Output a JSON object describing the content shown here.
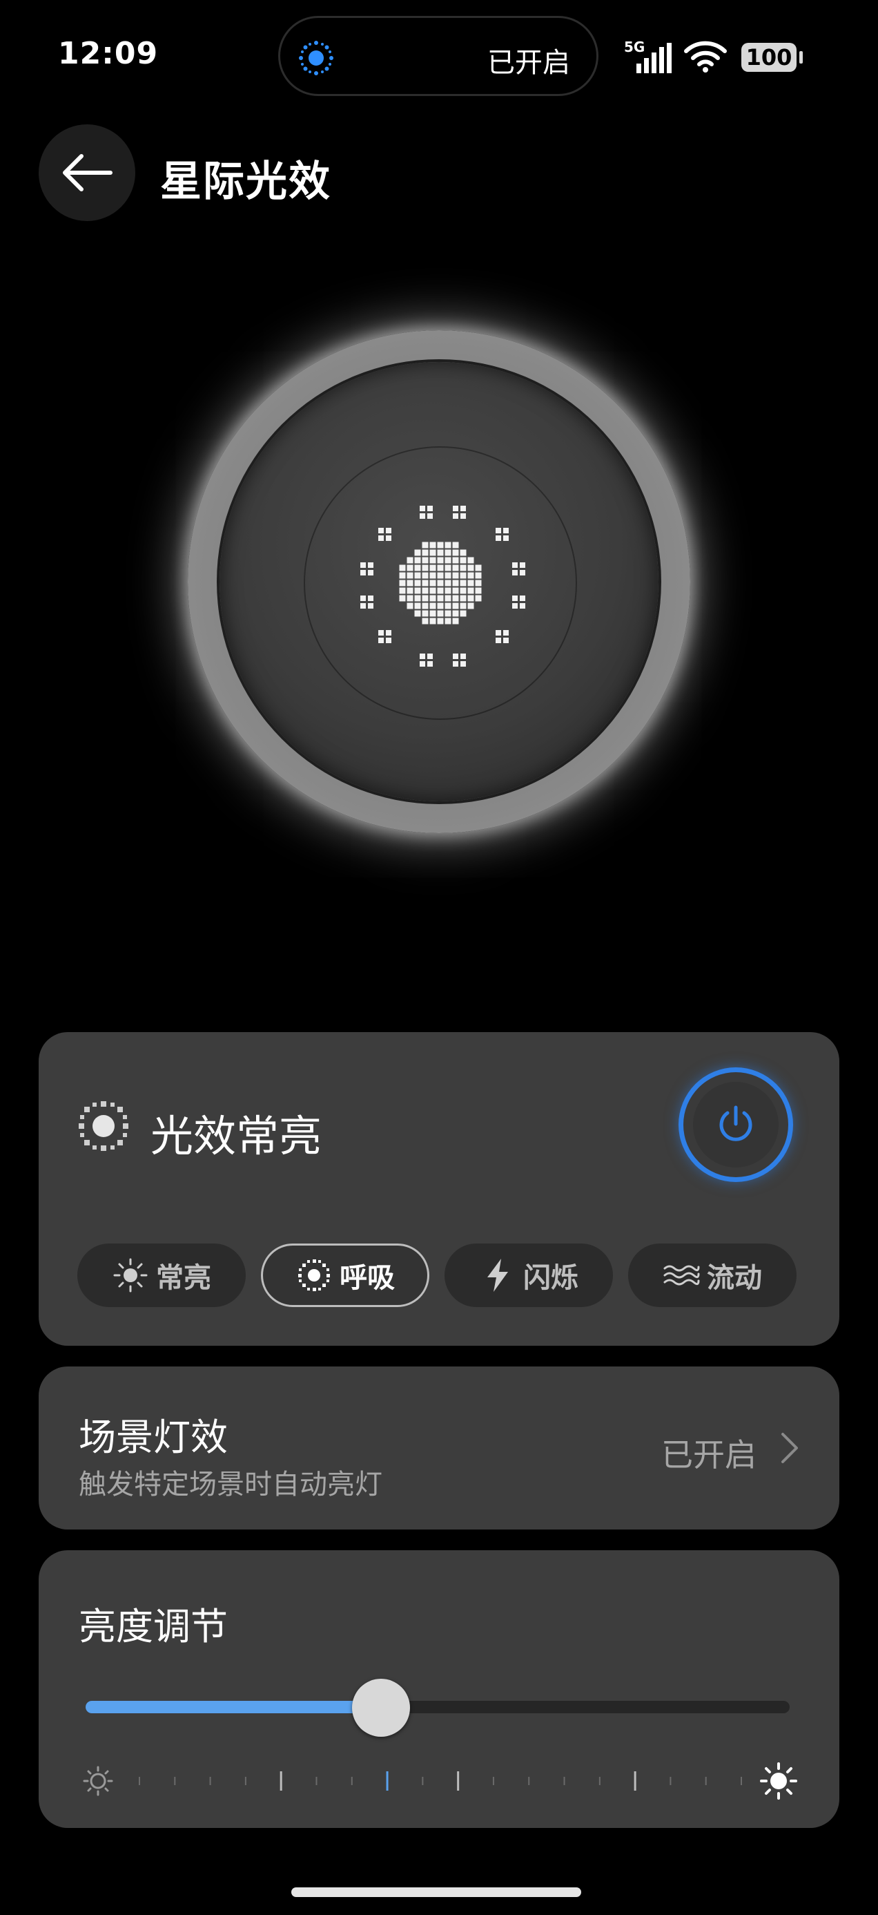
{
  "status_bar": {
    "time": "12:09",
    "island_text": "已开启",
    "network": "5G",
    "battery": "100"
  },
  "header": {
    "title": "星际光效",
    "back_icon": "arrow-left-icon"
  },
  "effect_card": {
    "title": "光效常亮",
    "power_on": true,
    "accent_color": "#2f7fe6",
    "modes": [
      {
        "label": "常亮",
        "icon": "sun-icon",
        "active": false
      },
      {
        "label": "呼吸",
        "icon": "breathing-icon",
        "active": true
      },
      {
        "label": "闪烁",
        "icon": "lightning-icon",
        "active": false
      },
      {
        "label": "流动",
        "icon": "wave-icon",
        "active": false
      }
    ]
  },
  "scene_card": {
    "title": "场景灯效",
    "subtitle": "触发特定场景时自动亮灯",
    "status": "已开启"
  },
  "brightness_card": {
    "title": "亮度调节",
    "level": 0.42,
    "fill_color": "#5aa2ee"
  }
}
